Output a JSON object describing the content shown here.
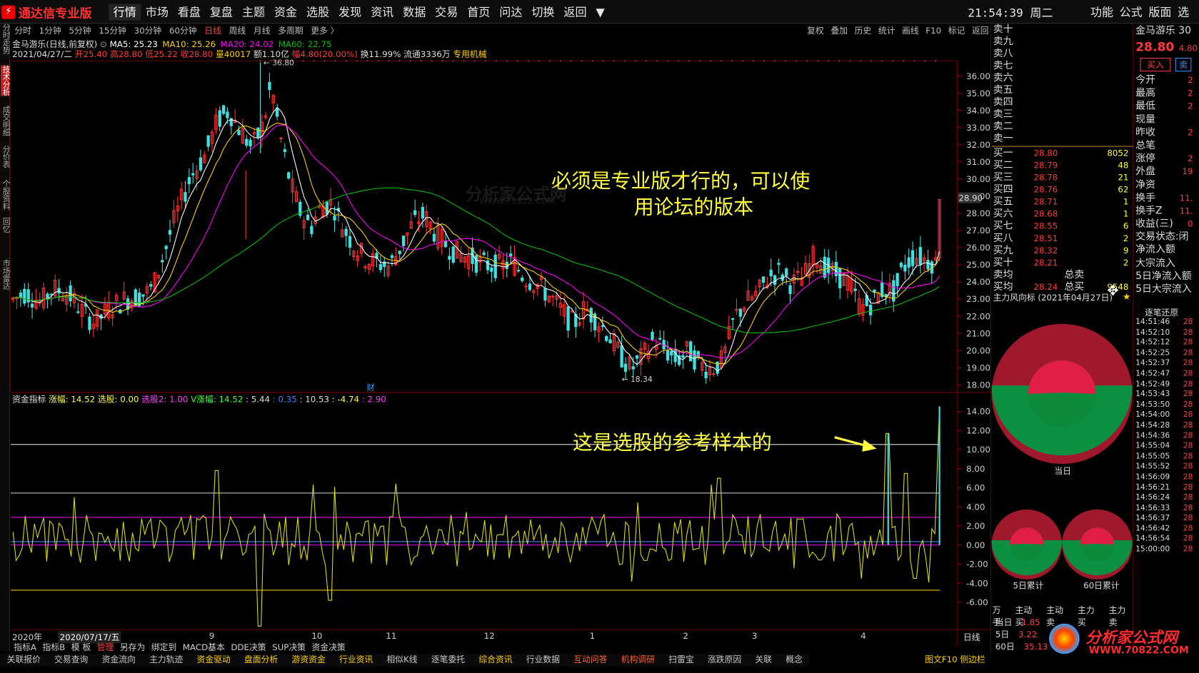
{
  "app": {
    "logo_text": "通达信专业版",
    "clock": "21:54:39 周二"
  },
  "menu": [
    "行情",
    "市场",
    "看盘",
    "复盘",
    "主题",
    "资金",
    "选股",
    "发现",
    "资讯",
    "数据",
    "交易",
    "首页",
    "问达",
    "切换",
    "返回",
    "▼"
  ],
  "right_menu": [
    "功能",
    "公式",
    "版面",
    "选"
  ],
  "left_rail": [
    "分时走势",
    "技术分析",
    "成交明细",
    "分价表",
    "个股资料",
    "回忆",
    "市场雷达"
  ],
  "periods": [
    "分时",
    "1分钟",
    "5分钟",
    "15分钟",
    "30分钟",
    "60分钟",
    "日线",
    "周线",
    "月线",
    "多周期",
    "更多 〉"
  ],
  "period_active": "日线",
  "tools": [
    "复权",
    "叠加",
    "历史",
    "统计",
    "画线",
    "F10",
    "标记",
    "返回"
  ],
  "info": {
    "name": "金马游乐(日线,前复权)",
    "ma": [
      {
        "t": "MA5: 25.23",
        "c": "#ffffff"
      },
      {
        "t": "MA10: 25.26",
        "c": "#ffd000"
      },
      {
        "t": "MA20: 24.02",
        "c": "#ff00ff"
      },
      {
        "t": "MA60: 22.75",
        "c": "#00c000"
      }
    ],
    "ohlc_date": "2021/04/27/二",
    "open": "开25.40",
    "high": "高28.80",
    "low": "低25.22",
    "close": "收28.80",
    "vol": "量40017",
    "amt": "额1.10亿",
    "chg": "幅4.80(20.00%)",
    "turnover": "换11.99%",
    "float": "流通3336万",
    "industry": "专用机械"
  },
  "main_chart": {
    "yticks": [
      "36.00",
      "35.00",
      "34.00",
      "33.00",
      "32.00",
      "31.00",
      "30.00",
      "29.00",
      "28.00",
      "27.00",
      "26.00",
      "25.00",
      "24.00",
      "23.00",
      "22.00",
      "21.00",
      "20.00",
      "19.00",
      "18.00"
    ],
    "high_label": "36.80",
    "low_label": "18.34",
    "cur_price": "28.90",
    "finance_marker": "财"
  },
  "indicator": {
    "name": "资金指标",
    "zf": "涨幅: 14.52",
    "xg": "选股: 0.00",
    "xg2": "选股2: 1.00",
    "vzf": "V涨幅: 14.52",
    "v1": ": 5.44",
    "v2": ": 0.35",
    "v3": ": 10.53",
    "v4": ": -4.74",
    "v5": ": 2.90",
    "yticks": [
      "14.00",
      "12.00",
      "10.00",
      "8.00",
      "6.00",
      "4.00",
      "2.00",
      "0.00",
      "-2.00",
      "-4.00",
      "-6.00"
    ]
  },
  "annotations": {
    "a1_line1": "必须是专业版才行的，可以使",
    "a1_line2": "用论坛的版本",
    "a2": "这是选股的参考样本的"
  },
  "watermark_top": "分析家公式网",
  "watermark_url": "WWW.70822.COM",
  "xaxis": {
    "year": "2020年",
    "date": "2020/07/17/五",
    "months": [
      "9",
      "10",
      "11",
      "12",
      "1",
      "2",
      "3",
      "4"
    ],
    "period": "日线"
  },
  "bottom_tabs": [
    "指标A",
    "指标B",
    "模 板",
    "管理",
    "另存为",
    "绑定到",
    "MACD基本",
    "DDE决策",
    "SUP决策",
    "资金决策"
  ],
  "bottom_tabs_sel": "管理",
  "bottom_tabs2": [
    {
      "t": "关联报价",
      "c": "#c8c8c8"
    },
    {
      "t": "交易查询",
      "c": "#c8c8c8"
    },
    {
      "t": "资金流向",
      "c": "#c8c8c8"
    },
    {
      "t": "主力轨迹",
      "c": "#c8c8c8"
    },
    {
      "t": "资金驱动",
      "c": "#ffd000"
    },
    {
      "t": "盘面分析",
      "c": "#ffd000"
    },
    {
      "t": "游资资金",
      "c": "#ffd000"
    },
    {
      "t": "行业资讯",
      "c": "#ffd000"
    },
    {
      "t": "相似K线",
      "c": "#c8c8c8"
    },
    {
      "t": "逐笔委托",
      "c": "#c8c8c8"
    },
    {
      "t": "综合资讯",
      "c": "#ffd000"
    },
    {
      "t": "行业数据",
      "c": "#c8c8c8"
    },
    {
      "t": "互动问答",
      "c": "#ff6030"
    },
    {
      "t": "机构调研",
      "c": "#ff6030"
    },
    {
      "t": "扫雷宝",
      "c": "#c8c8c8"
    },
    {
      "t": "涨跌原因",
      "c": "#c8c8c8"
    },
    {
      "t": "关联",
      "c": "#c8c8c8"
    },
    {
      "t": "概念",
      "c": "#c8c8c8"
    }
  ],
  "bottom_right": "图文F10 侧边栏",
  "orderbook": {
    "sells": [
      "卖十",
      "卖九",
      "卖八",
      "卖七",
      "卖六",
      "卖五",
      "卖四",
      "卖三",
      "卖二",
      "卖一"
    ],
    "buys": [
      {
        "l": "买一",
        "p": "28.80",
        "v": "8052"
      },
      {
        "l": "买二",
        "p": "28.79",
        "v": "48"
      },
      {
        "l": "买三",
        "p": "28.78",
        "v": "21"
      },
      {
        "l": "买四",
        "p": "28.76",
        "v": "62"
      },
      {
        "l": "买五",
        "p": "28.71",
        "v": "1"
      },
      {
        "l": "买六",
        "p": "28.68",
        "v": "1"
      },
      {
        "l": "买七",
        "p": "28.55",
        "v": "6"
      },
      {
        "l": "买八",
        "p": "28.51",
        "v": "2"
      },
      {
        "l": "买九",
        "p": "28.32",
        "v": "9"
      },
      {
        "l": "买十",
        "p": "28.21",
        "v": "2"
      }
    ],
    "avg_sell": "卖均",
    "total_sell": "总卖",
    "avg_buy": "买均",
    "avg_buy_px": "28.24",
    "total_buy": "总买",
    "total_buy_val": "9548"
  },
  "quote": {
    "name": "金马游乐 30",
    "price": "28.80",
    "chg": "4.80",
    "buy_btn": "买入",
    "sell_btn": "卖",
    "fields": [
      "今开",
      "最高",
      "最低",
      "现量",
      "昨收",
      "总笔",
      "涨停",
      "外盘",
      "净资",
      "换手",
      "换手Z",
      "收益(三)",
      "交易状态:闭",
      "净流入额",
      "大宗流入",
      "5日净流入额",
      "5日大宗流入"
    ],
    "vals": [
      "2",
      "2",
      "2",
      "",
      "2",
      "",
      "2",
      "19",
      "",
      "11.",
      "11.",
      "0",
      "",
      "",
      "",
      "",
      ""
    ]
  },
  "funds": {
    "title": "主力风向标 (2021年04月27日)",
    "today": "当日",
    "d5": "5日累计",
    "d60": "60日累计"
  },
  "stats": {
    "header": [
      "万手",
      "主动买",
      "主动卖",
      "主力买",
      "主力卖"
    ],
    "rows": [
      {
        "l": "当日",
        "v": "1.85"
      },
      {
        "l": "5日",
        "v": "3.22"
      },
      {
        "l": "60日",
        "v": "35.13"
      }
    ]
  },
  "trades": {
    "title": "逐笔还原",
    "times": [
      "14:51:46",
      "14:52:10",
      "14:52:12",
      "14:52:25",
      "14:52:37",
      "14:52:47",
      "14:52:49",
      "14:53:43",
      "14:53:50",
      "14:54:00",
      "14:54:28",
      "14:54:36",
      "14:55:04",
      "14:55:05",
      "14:55:52",
      "14:56:09",
      "14:56:21",
      "14:56:24",
      "14:56:33",
      "14:56:37",
      "14:56:42",
      "14:56:54",
      "15:00:00"
    ],
    "vals": [
      "28",
      "28",
      "28",
      "28",
      "28",
      "28",
      "28",
      "28",
      "28",
      "28",
      "28",
      "28",
      "28",
      "28",
      "28",
      "28",
      "28",
      "28",
      "28",
      "28",
      "28",
      "28",
      "28"
    ]
  }
}
